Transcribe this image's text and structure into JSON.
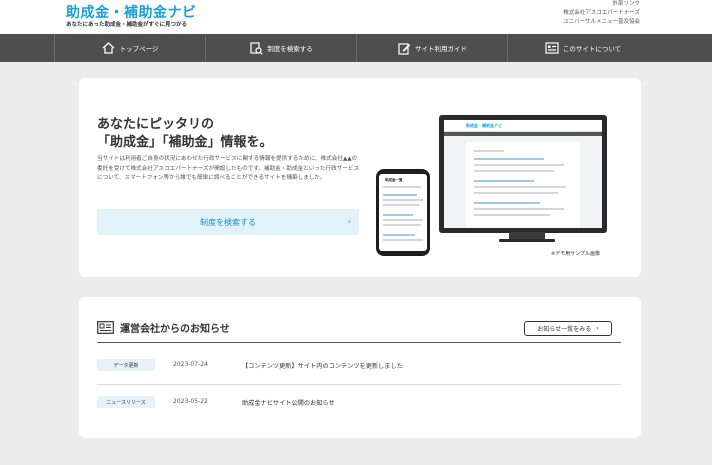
{
  "header": {
    "title": "助成金・補助金ナビ",
    "subtitle": "あなたにあった助成金・補助金がすぐに見つかる",
    "external_links": [
      "外部リンク",
      "株式会社アスコエパートナーズ",
      "ユニバーサルメニュー普及協会"
    ]
  },
  "nav": {
    "items": [
      {
        "label": "トップページ",
        "icon": "home-icon"
      },
      {
        "label": "制度を検索する",
        "icon": "search-document-icon"
      },
      {
        "label": "サイト利用ガイド",
        "icon": "guide-edit-icon"
      },
      {
        "label": "このサイトについて",
        "icon": "info-list-icon"
      }
    ]
  },
  "hero": {
    "heading_line1": "あなたにピッタリの",
    "heading_line2": "「助成金」「補助金」情報を。",
    "description": "当サイトは利用者ご自身の状況にあわせた行政サービスに関する情報を提供するために、株式会社▲▲の委託を受けて株式会社アスコエパートナーズが開設したものです。補助金・助成金といった行政サービスについて、スマートフォン等から誰でも簡単に調べることができるサイトを構築しました。",
    "search_button": "制度を検索する",
    "demo_note": "※デモ用サンプル画像",
    "mock_title": "助成金・補助金ナビ",
    "mock_phone_title": "助成金一覧"
  },
  "news": {
    "title": "運営会社からのお知らせ",
    "more_label": "お知らせ一覧をみる",
    "items": [
      {
        "tag": "データ更新",
        "date": "2023-07-24",
        "text": "【コンテンツ更新】サイト内のコンテンツを更新しました"
      },
      {
        "tag": "ニュースリリース",
        "date": "2023-05-22",
        "text": "助成金ナビサイト公開のお知らせ"
      }
    ]
  },
  "colors": {
    "brand": "#1aa0d8",
    "nav_bg": "#4e4e4e",
    "page_bg": "#ececec",
    "search_bg": "#e2f2fb"
  }
}
